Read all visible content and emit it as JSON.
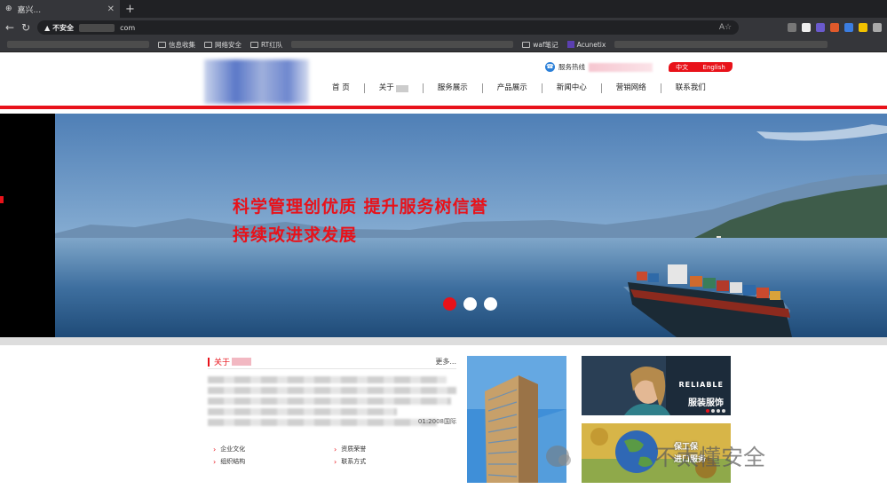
{
  "browser": {
    "tab_title": "嘉兴...",
    "address_warning": "▲ 不安全",
    "address_suffix": "com",
    "address_right_icons": "A☆",
    "bookmarks": [
      "信息收集",
      "网络安全",
      "RT红队",
      "waf笔记",
      "Acunetix"
    ]
  },
  "header": {
    "hotline_label": "服务热线",
    "lang_cn": "中文",
    "lang_en": "English"
  },
  "nav": {
    "items": [
      "首 页",
      "关于",
      "服务展示",
      "产品展示",
      "新闻中心",
      "营销网络",
      "联系我们"
    ]
  },
  "banner": {
    "slogan_line1": "科学管理创优质 提升服务树信誉",
    "slogan_line2": "持续改进求发展",
    "slide_count": 3,
    "active_slide": 1
  },
  "about": {
    "title": "关于",
    "more": "更多...",
    "text_tail": "01:2008国际",
    "links": [
      "企业文化",
      "资质荣誉",
      "组织结构",
      "联系方式"
    ]
  },
  "promo": {
    "fashion_brand": "RELIABLE",
    "fashion_label": "服装服饰",
    "trade_label_1": "保工保",
    "trade_label_2": "进口服务"
  },
  "watermark": {
    "text": "不太懂安全"
  },
  "colors": {
    "accent_red": "#e8121a",
    "chrome_dark": "#202124"
  }
}
